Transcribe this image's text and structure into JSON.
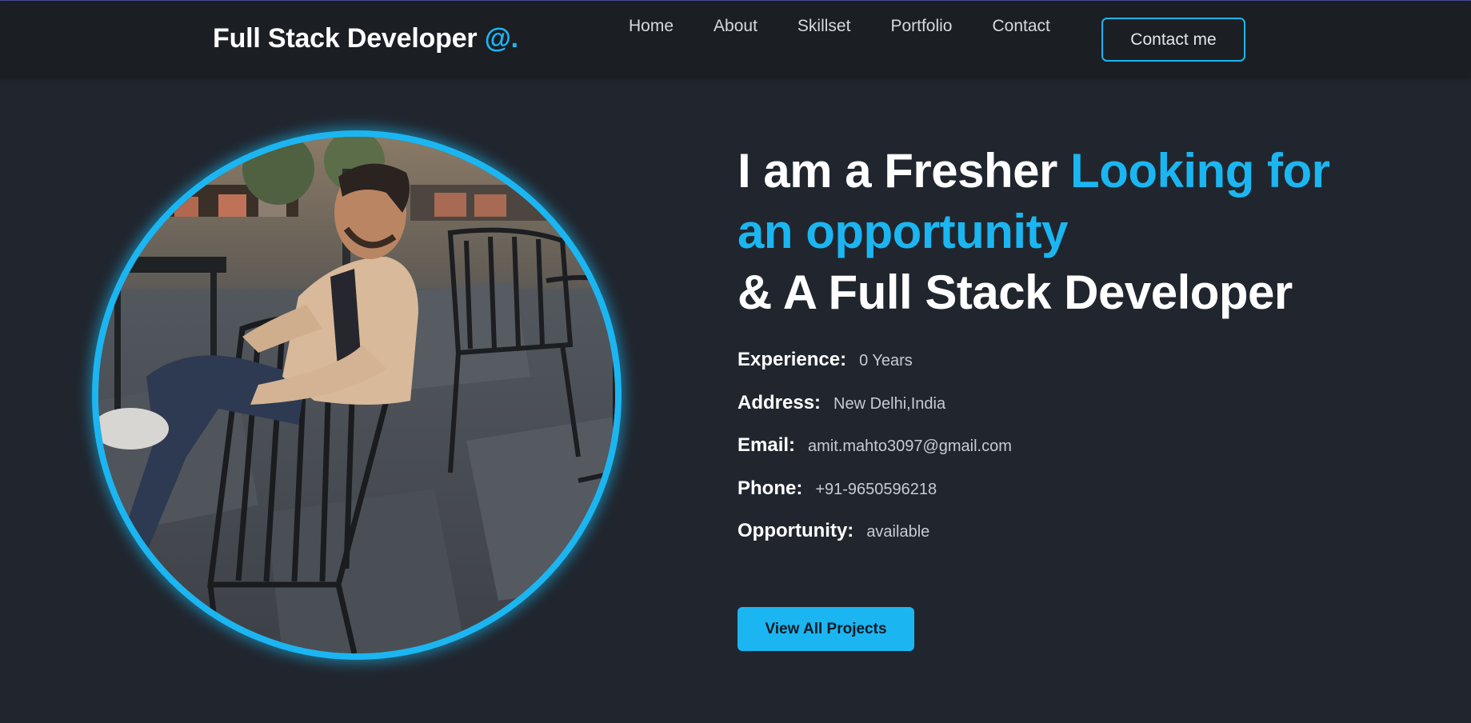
{
  "navbar": {
    "brand_text": "Full Stack Developer ",
    "brand_accent": "@.",
    "links": [
      {
        "label": "Home"
      },
      {
        "label": "About"
      },
      {
        "label": "Skillset"
      },
      {
        "label": "Portfolio"
      },
      {
        "label": "Contact"
      }
    ],
    "cta_label": "Contact me"
  },
  "hero": {
    "headline_part1": "I am a Fresher ",
    "headline_highlight": "Looking for an opportunity",
    "headline_part2": "& A Full Stack Developer",
    "info": [
      {
        "label": "Experience:",
        "value": "0 Years"
      },
      {
        "label": "Address:",
        "value": "New Delhi,India"
      },
      {
        "label": "Email:",
        "value": "amit.mahto3097@gmail.com"
      },
      {
        "label": "Phone:",
        "value": "+91-9650596218"
      },
      {
        "label": "Opportunity:",
        "value": "available"
      }
    ],
    "button_label": "View All Projects"
  },
  "colors": {
    "background": "#21262e",
    "navbar": "#1b1e23",
    "accent": "#1bb6f1",
    "text": "#ffffff"
  }
}
